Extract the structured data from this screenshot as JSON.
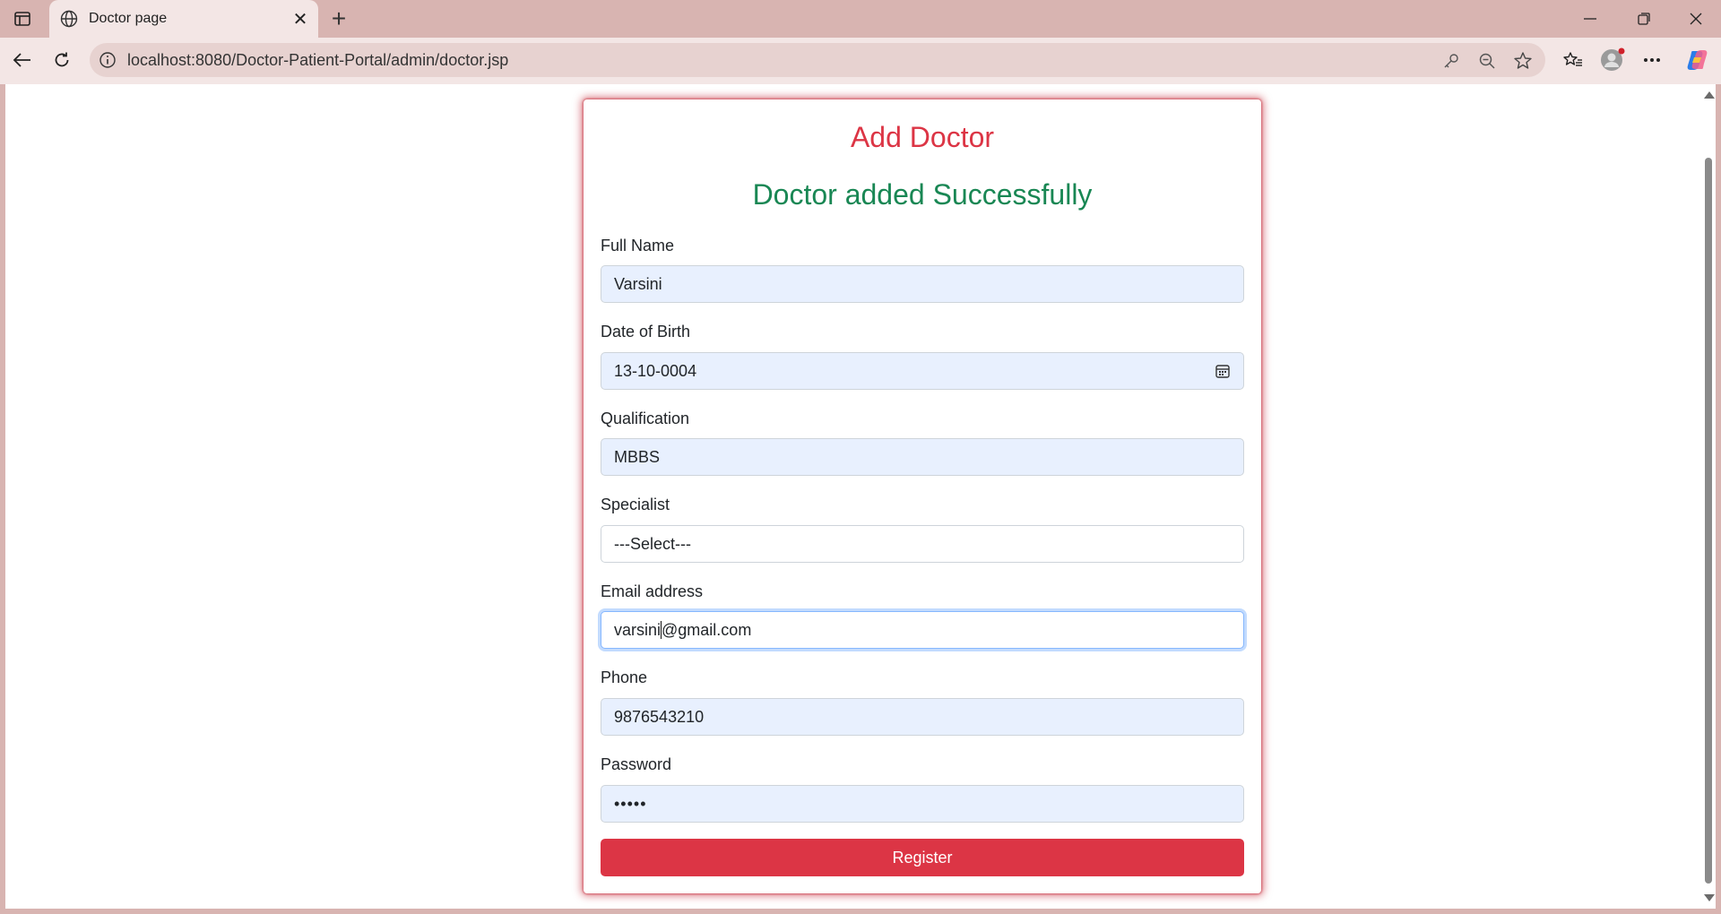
{
  "browser": {
    "tab_title": "Doctor page",
    "url": "localhost:8080/Doctor-Patient-Portal/admin/doctor.jsp"
  },
  "form": {
    "title": "Add Doctor",
    "success_message": "Doctor added Successfully",
    "full_name": {
      "label": "Full Name",
      "value": "Varsini"
    },
    "dob": {
      "label": "Date of Birth",
      "value": "13-10-0004"
    },
    "qualification": {
      "label": "Qualification",
      "value": "MBBS"
    },
    "specialist": {
      "label": "Specialist",
      "selected": "---Select---"
    },
    "email": {
      "label": "Email address",
      "value_before_caret": "varsini",
      "value_after_caret": "@gmail.com"
    },
    "phone": {
      "label": "Phone",
      "value": "9876543210"
    },
    "password": {
      "label": "Password",
      "masked": "•••••"
    },
    "register_label": "Register"
  },
  "colors": {
    "accent_red": "#dc3545",
    "success_green": "#198754",
    "autofill_blue": "#e8f0fe"
  }
}
